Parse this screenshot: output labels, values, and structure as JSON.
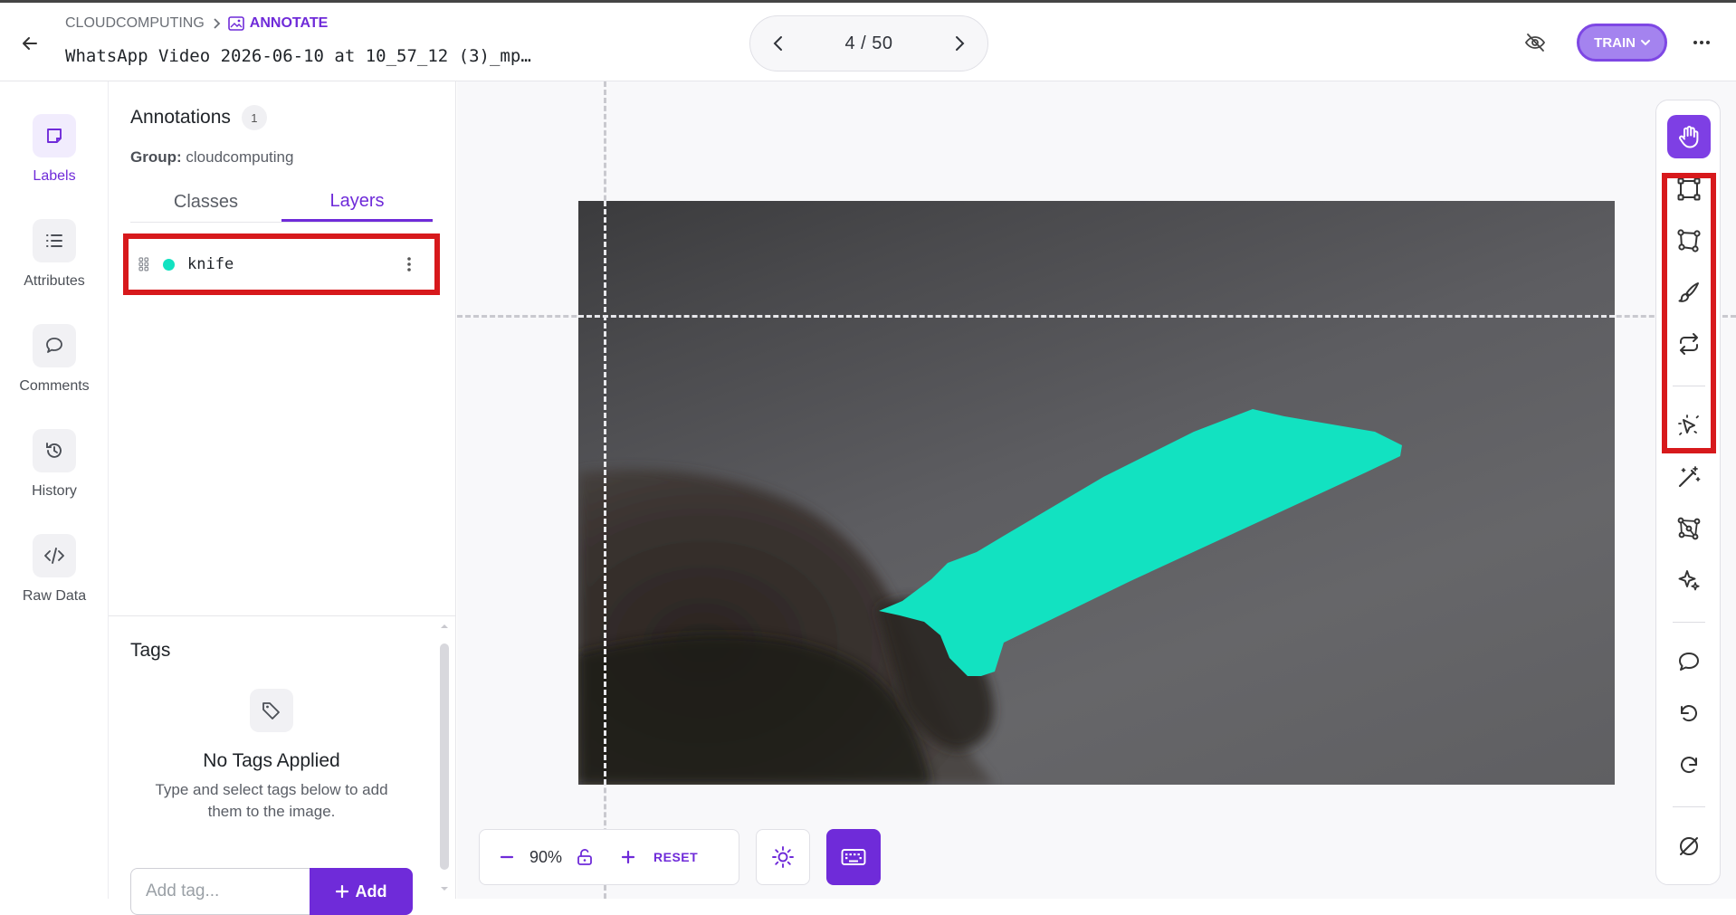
{
  "header": {
    "breadcrumb": {
      "project": "CLOUDCOMPUTING",
      "current": "ANNOTATE"
    },
    "file_title": "WhatsApp Video 2026-06-10 at 10_57_12 (3)_mp…",
    "pager": {
      "text": "4 / 50"
    },
    "train_label": "TRAIN"
  },
  "leftnav": {
    "items": [
      {
        "label": "Labels",
        "icon": "labels-icon"
      },
      {
        "label": "Attributes",
        "icon": "list-icon"
      },
      {
        "label": "Comments",
        "icon": "comment-icon"
      },
      {
        "label": "History",
        "icon": "history-icon"
      },
      {
        "label": "Raw Data",
        "icon": "code-icon"
      }
    ],
    "active": "Labels"
  },
  "panel": {
    "title": "Annotations",
    "count": "1",
    "group_label": "Group:",
    "group_value": "cloudcomputing",
    "tabs": [
      {
        "label": "Classes"
      },
      {
        "label": "Layers"
      }
    ],
    "active_tab": "Layers",
    "layers": [
      {
        "name": "knife",
        "color": "#12e2c1"
      }
    ]
  },
  "tags": {
    "title": "Tags",
    "empty_title": "No Tags Applied",
    "empty_hint": "Type and select tags below to add them to the image.",
    "input_placeholder": "Add tag...",
    "add_label": "Add"
  },
  "canvas": {
    "zoom": "90%",
    "reset_label": "RESET"
  },
  "colors": {
    "accent": "#6f2bd9",
    "annotation": "#12e2c1",
    "highlight": "#d7191c"
  },
  "tools": [
    "hand-icon",
    "rectangle-icon",
    "polygon-icon",
    "brush-icon",
    "convert-icon",
    "smart-select-icon",
    "magic-wand-icon",
    "keypoints-icon",
    "ai-sparkle-icon",
    "comment-icon",
    "undo-icon",
    "redo-icon",
    "clear-icon"
  ]
}
